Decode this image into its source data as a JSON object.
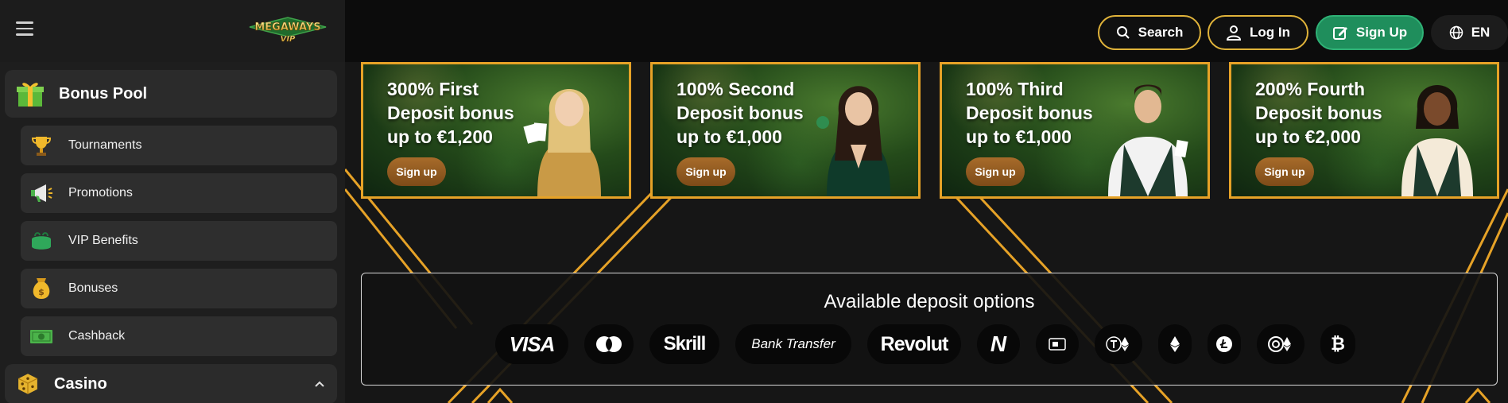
{
  "header": {
    "logo_text_top": "MEGAWAYS",
    "logo_text_bottom": "VIP",
    "search_label": "Search",
    "login_label": "Log In",
    "signup_label": "Sign Up",
    "language_label": "EN"
  },
  "sidebar": {
    "categories": [
      {
        "label": "Bonus Pool",
        "icon": "gift-box-icon"
      },
      {
        "label": "Casino",
        "icon": "dice-icon"
      }
    ],
    "items": [
      {
        "label": "Tournaments",
        "icon": "trophy-icon"
      },
      {
        "label": "Promotions",
        "icon": "megaphone-icon"
      },
      {
        "label": "VIP Benefits",
        "icon": "green-purse-icon"
      },
      {
        "label": "Bonuses",
        "icon": "money-bag-icon"
      },
      {
        "label": "Cashback",
        "icon": "banknote-icon"
      }
    ]
  },
  "promos": [
    {
      "title_line1": "300% First",
      "title_line2": "Deposit bonus",
      "title_line3": "up to €1,200",
      "button": "Sign up"
    },
    {
      "title_line1": "100% Second",
      "title_line2": "Deposit bonus",
      "title_line3": "up to €1,000",
      "button": "Sign up"
    },
    {
      "title_line1": "100% Third",
      "title_line2": "Deposit bonus",
      "title_line3": "up to €1,000",
      "button": "Sign up"
    },
    {
      "title_line1": "200% Fourth",
      "title_line2": "Deposit bonus",
      "title_line3": "up to €2,000",
      "button": "Sign up"
    }
  ],
  "deposit": {
    "title": "Available deposit options",
    "methods": [
      {
        "label": "VISA",
        "icon": "visa-icon"
      },
      {
        "label": "",
        "icon": "mastercard-icon"
      },
      {
        "label": "Skrill",
        "icon": "skrill-icon"
      },
      {
        "label": "Bank Transfer",
        "icon": "bank-transfer-icon"
      },
      {
        "label": "Revolut",
        "icon": "revolut-icon"
      },
      {
        "label": "N",
        "icon": "neteller-icon"
      },
      {
        "label": "",
        "icon": "card-chip-icon"
      },
      {
        "label": "",
        "icon": "tether-ethereum-icon"
      },
      {
        "label": "",
        "icon": "ethereum-icon"
      },
      {
        "label": "",
        "icon": "litecoin-icon"
      },
      {
        "label": "",
        "icon": "usdc-ethereum-icon"
      },
      {
        "label": "",
        "icon": "bitcoin-icon"
      }
    ]
  },
  "colors": {
    "accent_gold": "#e6a227",
    "signup_green": "#1f8e5c",
    "sidebar_bg": "#1e1e1e",
    "topbar_bg": "#0c0c0c"
  }
}
